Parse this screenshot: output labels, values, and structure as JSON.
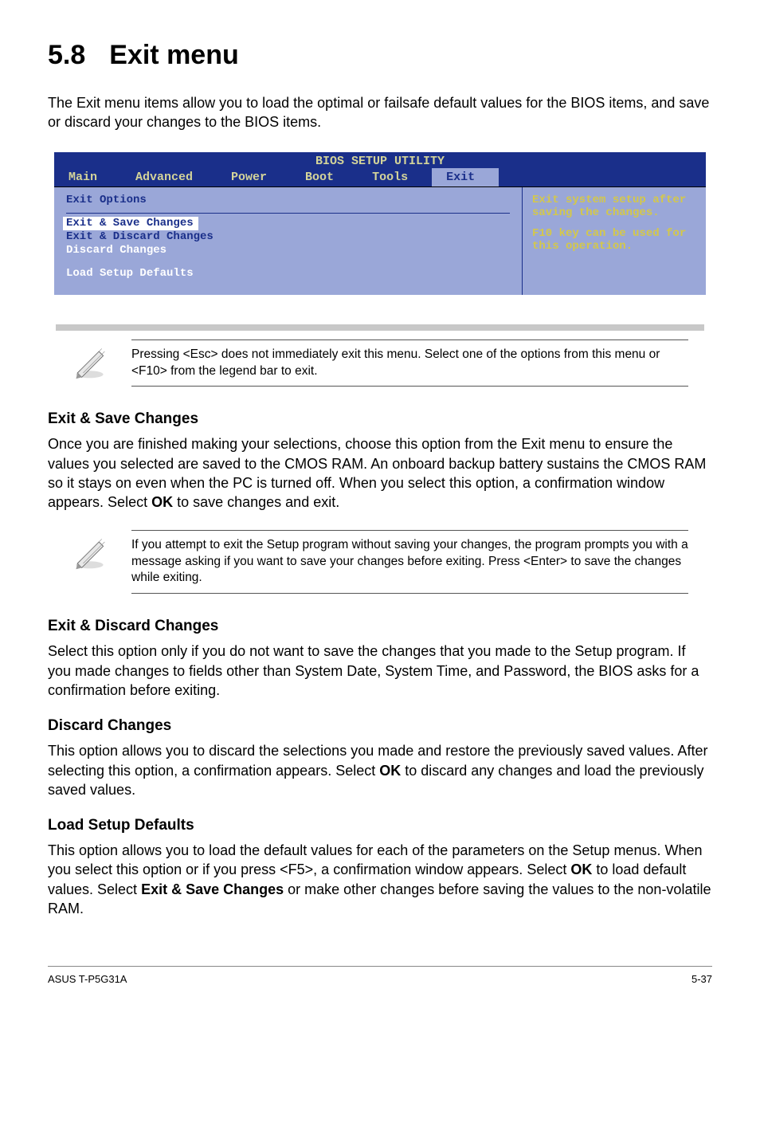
{
  "heading": {
    "num": "5.8",
    "title": "Exit menu"
  },
  "intro": "The Exit menu items allow you to load the optimal or failsafe default values for the BIOS items, and save or discard your changes to the BIOS items.",
  "bios": {
    "titlebar": "BIOS SETUP UTILITY",
    "tabs": [
      "Main",
      "Advanced",
      "Power",
      "Boot",
      "Tools",
      "Exit"
    ],
    "left": {
      "group_title": "Exit Options",
      "items": [
        {
          "text": "Exit & Save Changes",
          "type": "sel"
        },
        {
          "text": "Exit & Discard Changes",
          "type": "dark"
        },
        {
          "text": "Discard Changes",
          "type": "white"
        },
        {
          "text": "Load Setup Defaults",
          "type": "white"
        }
      ]
    },
    "right": {
      "line1": "Exit system setup after saving the changes.",
      "line2": "F10 key can be used for this operation."
    }
  },
  "note1": "Pressing <Esc> does not immediately exit this menu. Select one of the options from this menu or <F10> from the legend bar to exit.",
  "sections": {
    "s1": {
      "title": "Exit & Save Changes",
      "body_pre": "Once you are finished making your selections, choose this option from the Exit menu to ensure the values you selected are saved to the CMOS RAM. An onboard backup battery sustains the CMOS RAM so it stays on even when the PC is turned off. When you select this option, a confirmation window appears. Select ",
      "body_bold": "OK",
      "body_post": " to save changes and exit."
    },
    "note2": " If you attempt to exit the Setup program without saving your changes, the program prompts you with a message asking if you want to save your changes before exiting. Press <Enter>  to save the  changes while exiting.",
    "s2": {
      "title": "Exit & Discard Changes",
      "body": "Select this option only if you do not want to save the changes that you  made to the Setup program. If you made changes to fields other than System Date, System Time, and Password, the BIOS asks for a confirmation before exiting."
    },
    "s3": {
      "title": "Discard Changes",
      "body_pre": "This option allows you to discard the selections you made and restore the previously saved values. After selecting this option, a confirmation appears. Select ",
      "body_bold": "OK",
      "body_post": " to discard any changes and load the previously saved values."
    },
    "s4": {
      "title": "Load Setup Defaults",
      "body_pre": "This option allows you to load the default values for each of the parameters on the Setup menus. When you select this option or if you press <F5>, a confirmation window appears. Select ",
      "body_bold1": "OK",
      "body_mid": " to load default values. Select ",
      "body_bold2": "Exit & Save Changes",
      "body_post": " or make other changes before saving the values to the non-volatile RAM."
    }
  },
  "footer": {
    "left": "ASUS T-P5G31A",
    "right": "5-37"
  }
}
